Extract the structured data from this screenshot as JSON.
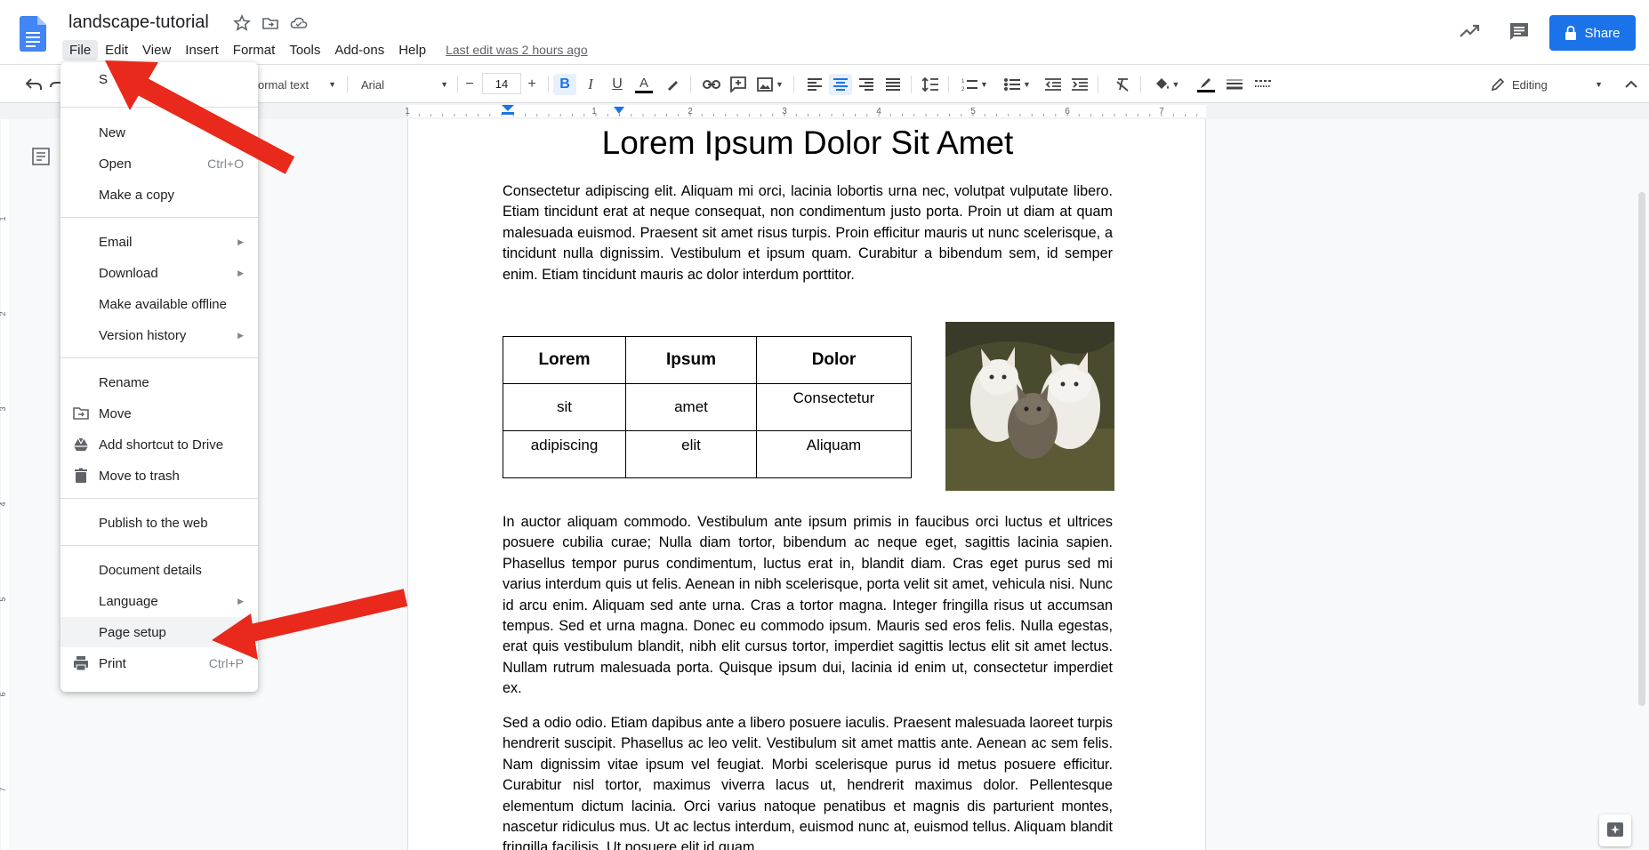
{
  "app": {
    "doc_title": "landscape-tutorial",
    "menus": [
      "File",
      "Edit",
      "View",
      "Insert",
      "Format",
      "Tools",
      "Add-ons",
      "Help"
    ],
    "last_edit": "Last edit was 2 hours ago",
    "share_label": "Share"
  },
  "toolbar": {
    "style_label": "ormal text",
    "font_label": "Arial",
    "font_size": "14",
    "minus": "−",
    "plus": "+",
    "mode_label": "Editing"
  },
  "ruler": {
    "h_marks": [
      "1",
      "1",
      "2",
      "3",
      "4",
      "5",
      "6",
      "7"
    ],
    "v_marks": [
      "1",
      "2",
      "3",
      "4",
      "5",
      "6",
      "7"
    ]
  },
  "file_menu": {
    "partial_first": "S",
    "items": [
      {
        "label": "New",
        "shortcut": "",
        "submenu": false
      },
      {
        "label": "Open",
        "shortcut": "Ctrl+O",
        "submenu": false
      },
      {
        "label": "Make a copy",
        "shortcut": "",
        "submenu": false
      },
      {
        "label": "Email",
        "shortcut": "",
        "submenu": true
      },
      {
        "label": "Download",
        "shortcut": "",
        "submenu": true
      },
      {
        "label": "Make available offline",
        "shortcut": "",
        "submenu": false
      },
      {
        "label": "Version history",
        "shortcut": "",
        "submenu": true
      },
      {
        "label": "Rename",
        "shortcut": "",
        "submenu": false
      },
      {
        "label": "Move",
        "shortcut": "",
        "submenu": false,
        "icon": "folder-move-icon"
      },
      {
        "label": "Add shortcut to Drive",
        "shortcut": "",
        "submenu": false,
        "icon": "drive-icon"
      },
      {
        "label": "Move to trash",
        "shortcut": "",
        "submenu": false,
        "icon": "trash-icon"
      },
      {
        "label": "Publish to the web",
        "shortcut": "",
        "submenu": false
      },
      {
        "label": "Document details",
        "shortcut": "",
        "submenu": false
      },
      {
        "label": "Language",
        "shortcut": "",
        "submenu": true
      },
      {
        "label": "Page setup",
        "shortcut": "",
        "submenu": false,
        "highlighted": true
      },
      {
        "label": "Print",
        "shortcut": "Ctrl+P",
        "submenu": false,
        "icon": "print-icon"
      }
    ]
  },
  "document": {
    "heading": "Lorem Ipsum Dolor Sit Amet",
    "para1": "Consectetur adipiscing elit. Aliquam mi orci, lacinia lobortis urna nec, volutpat vulputate libero. Etiam tincidunt erat at neque consequat, non condimentum justo porta. Proin ut diam at quam malesuada euismod. Praesent sit amet risus turpis. Proin efficitur mauris ut nunc scelerisque, a tincidunt nulla dignissim. Vestibulum et ipsum quam. Curabitur a bibendum sem, id semper enim. Etiam tincidunt mauris ac dolor interdum porttitor.",
    "table": {
      "header": [
        "Lorem",
        "Ipsum",
        "Dolor"
      ],
      "rows": [
        [
          "sit",
          "amet",
          "Consectetur"
        ],
        [
          "adipiscing",
          "elit",
          "Aliquam"
        ]
      ]
    },
    "para2": "In auctor aliquam commodo. Vestibulum ante ipsum primis in faucibus orci luctus et ultrices posuere cubilia curae; Nulla diam tortor, bibendum ac neque eget, sagittis lacinia sapien. Phasellus tempor purus condimentum, luctus erat in, blandit diam. Cras eget purus sed mi varius interdum quis ut felis. Aenean in nibh scelerisque, porta velit sit amet, vehicula nisi. Nunc id arcu enim. Aliquam sed ante urna. Cras a tortor magna. Integer fringilla risus ut accumsan tempus. Sed et urna magna. Donec eu commodo ipsum. Mauris sed eros felis. Nulla egestas, erat quis vestibulum blandit, nibh elit cursus tortor, imperdiet sagittis lectus elit sit amet lectus. Nullam rutrum malesuada porta. Quisque ipsum dui, lacinia id enim ut, consectetur imperdiet ex.",
    "para3": "Sed a odio odio. Etiam dapibus ante a libero posuere iaculis. Praesent malesuada laoreet turpis hendrerit suscipit. Phasellus ac leo velit. Vestibulum sit amet mattis ante. Aenean ac sem felis. Nam dignissim vitae ipsum vel feugiat. Morbi scelerisque purus id metus posuere efficitur. Curabitur nisl tortor, maximus viverra lacus ut, hendrerit maximus dolor. Pellentesque elementum dictum lacinia. Orci varius natoque penatibus et magnis dis parturient montes, nascetur ridiculus mus. Ut ac lectus interdum, euismod nunc at, euismod tellus. Aliquam blandit fringilla facilisis. Ut posuere elit id quam"
  },
  "colors": {
    "accent": "#1a73e8",
    "annotation_arrow": "#e8291c"
  }
}
